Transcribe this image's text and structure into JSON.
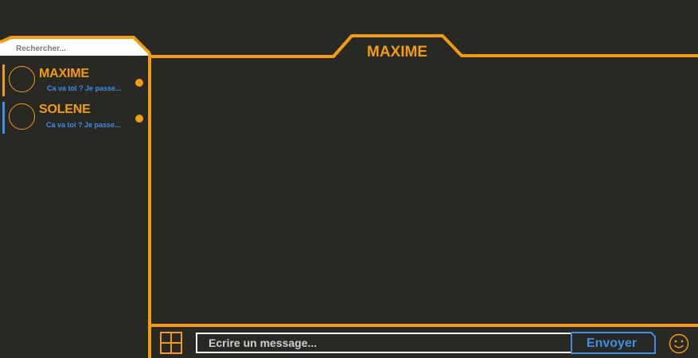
{
  "colors": {
    "background": "#282824",
    "accent": "#f39c12",
    "link_blue": "#3d8ee6",
    "input_border": "#ffffff"
  },
  "sidebar": {
    "search_placeholder": "Rechercher...",
    "contacts": [
      {
        "name": "MAXIME",
        "preview": "Ca va  toi  ? Je passe...",
        "indicator_color": "#f39c12",
        "unread": true
      },
      {
        "name": "SOLENE",
        "preview": "Ca va  toi  ? Je passe...",
        "indicator_color": "#3d8ee6",
        "unread": true
      }
    ]
  },
  "chat": {
    "title": "MAXIME"
  },
  "composer": {
    "attach_icon": "grid-icon",
    "placeholder": "Ecrire un message...",
    "send_label": "Envoyer",
    "emoji_icon": "smiley-icon"
  }
}
